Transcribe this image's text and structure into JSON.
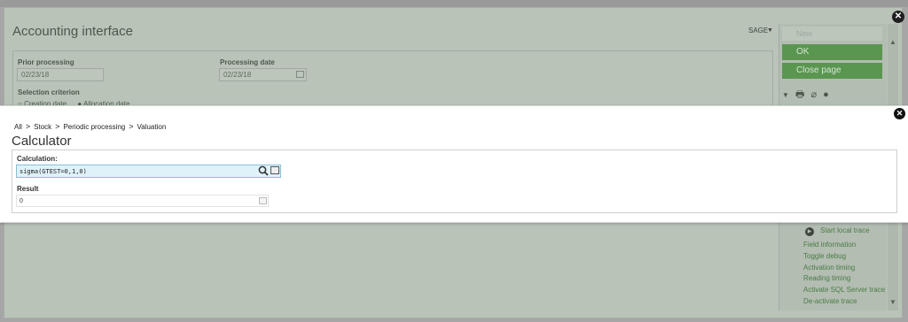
{
  "app": {
    "title": "Accounting interface",
    "user_menu": "SAGE"
  },
  "form": {
    "prior_processing_label": "Prior processing",
    "prior_processing_value": "02/23/18",
    "processing_date_label": "Processing date",
    "processing_date_value": "02/23/18",
    "selection_criterion_label": "Selection criterion",
    "radio_options": [
      "Creation date",
      "Allocation date"
    ]
  },
  "actions": {
    "new_label": "New",
    "ok_label": "OK",
    "close_page_label": "Close page",
    "start_local_trace": "Start local trace",
    "links": [
      "Field information",
      "Toggle debug",
      "Activation timing",
      "Reading timing",
      "Activate SQL Server trace",
      "De-activate trace"
    ]
  },
  "modal": {
    "breadcrumbs": [
      "All",
      "Stock",
      "Periodic processing",
      "Valuation"
    ],
    "title": "Calculator",
    "calculation_label": "Calculation:",
    "calculation_value": "sigma(GTEST=0,1,0)",
    "result_label": "Result",
    "result_value": "0"
  },
  "colors": {
    "overlay_green": "#b9c3b8",
    "button_green": "#5a9650",
    "input_focus_blue": "#dff2f9"
  }
}
